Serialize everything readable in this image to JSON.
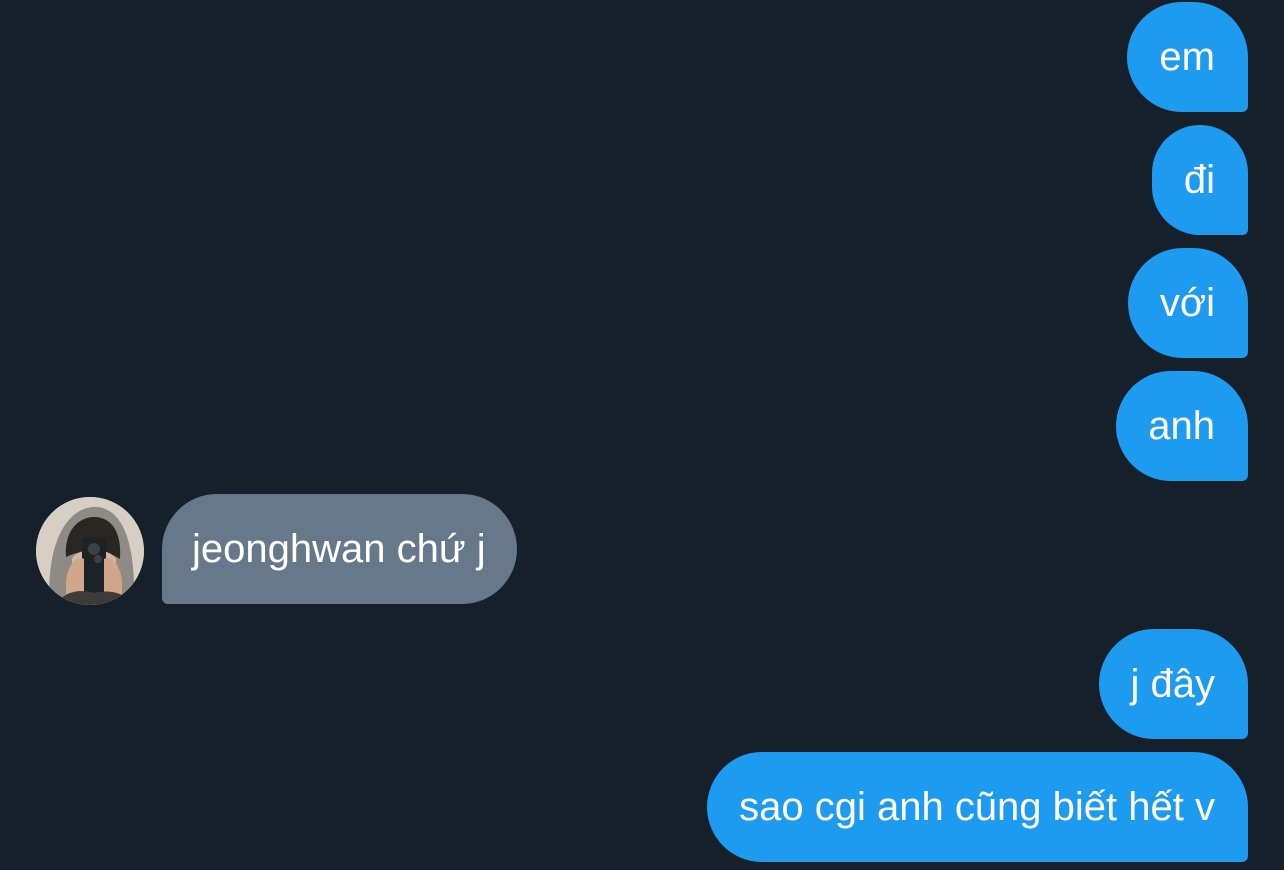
{
  "conversation": {
    "messages": [
      {
        "from": "me",
        "text": "em"
      },
      {
        "from": "me",
        "text": "đi"
      },
      {
        "from": "me",
        "text": "với"
      },
      {
        "from": "me",
        "text": "anh"
      },
      {
        "from": "other",
        "text": "jeonghwan chứ j"
      },
      {
        "from": "me",
        "text": "j đây"
      },
      {
        "from": "me",
        "text": "sao cgi anh cũng biết hết v"
      }
    ]
  },
  "colors": {
    "background": "#16202a",
    "sent_bubble": "#1d9bf0",
    "received_bubble": "#66788a",
    "text": "#ffffff"
  },
  "icons": {
    "avatar": "user-avatar-photo"
  }
}
